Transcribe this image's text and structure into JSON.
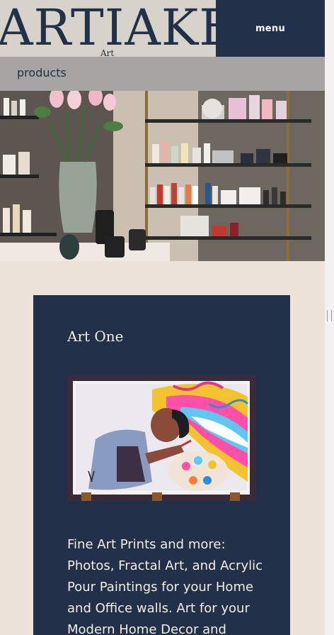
{
  "header": {
    "logo_text": "ARTIAKE",
    "logo_sub": "Art",
    "menu_label": "menu"
  },
  "nav": {
    "items": [
      {
        "label": "products"
      }
    ]
  },
  "hero": {
    "image_alt": "Shop shelves with cosmetics, vase of tulips"
  },
  "card": {
    "title": "Art One",
    "image_alt": "Painter painting a colorful rainbow canvas",
    "description": "Fine Art Prints and more: Photos, Fractal Art, and Acrylic Pour Paintings for your Home and Office walls. Art for your Modern Home Decor and"
  },
  "colors": {
    "navy": "#223049",
    "header_bg": "#d8d3ca",
    "nav_bg": "#a6a5a3",
    "page_bg": "#eee3da"
  }
}
